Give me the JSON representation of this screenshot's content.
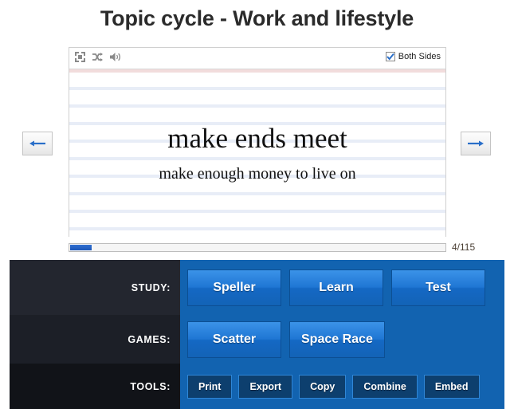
{
  "page": {
    "title": "Topic cycle - Work and lifestyle"
  },
  "card": {
    "toolbar": {
      "fullscreen_icon": "fullscreen-icon",
      "shuffle_icon": "shuffle-icon",
      "audio_icon": "speaker-icon",
      "both_sides_label": "Both Sides",
      "both_sides_checked": true
    },
    "term": "make ends meet",
    "definition": "make enough money to live on",
    "rule_line_count": 10
  },
  "progress": {
    "counter": "4/115",
    "current": 4,
    "total": 115,
    "percent": 3.5
  },
  "nav": {
    "prev_label": "←",
    "next_label": "→"
  },
  "bottom": {
    "rows": [
      {
        "label": "STUDY:",
        "style": "big",
        "buttons": [
          "Speller",
          "Learn",
          "Test"
        ]
      },
      {
        "label": "GAMES:",
        "style": "big",
        "buttons": [
          "Scatter",
          "Space Race"
        ]
      },
      {
        "label": "TOOLS:",
        "style": "small",
        "buttons": [
          "Print",
          "Export",
          "Copy",
          "Combine",
          "Embed"
        ]
      }
    ]
  },
  "colors": {
    "panel_blue": "#1263b0",
    "button_blue": "#1f76d4",
    "label_dark": "#23262f",
    "progress_blue": "#1c56b8",
    "rule_blue": "#e8edf7",
    "rule_pink": "#f2dcdc"
  }
}
